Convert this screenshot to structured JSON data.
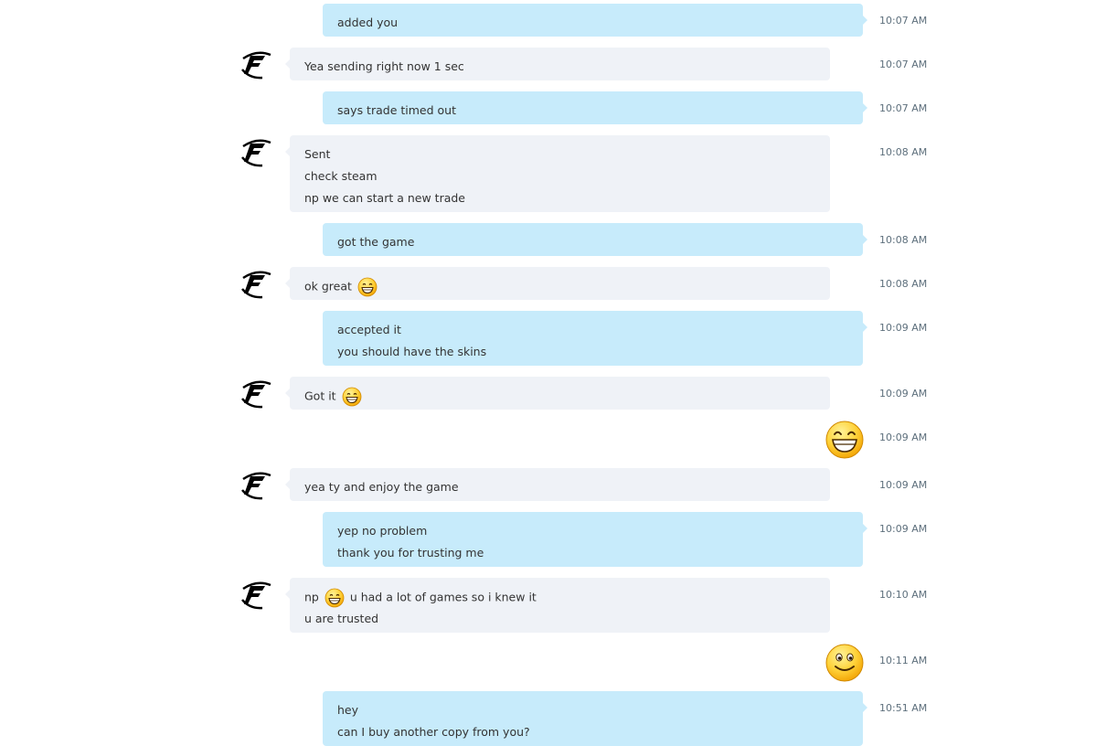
{
  "messages": [
    {
      "dir": "out",
      "lines": [
        "added you"
      ],
      "time": "10:07 AM"
    },
    {
      "dir": "in",
      "lines": [
        "Yea sending right now 1 sec"
      ],
      "time": "10:07 AM"
    },
    {
      "dir": "out",
      "lines": [
        "says trade timed out"
      ],
      "time": "10:07 AM"
    },
    {
      "dir": "in",
      "lines": [
        "Sent",
        "check steam",
        "np we can start a new trade"
      ],
      "time": "10:08 AM"
    },
    {
      "dir": "out",
      "lines": [
        "got the game"
      ],
      "time": "10:08 AM"
    },
    {
      "dir": "in",
      "lines": [
        "ok great",
        ""
      ],
      "time": "10:08 AM"
    },
    {
      "dir": "out",
      "lines": [
        "accepted it",
        "you should have the skins"
      ],
      "time": "10:09 AM"
    },
    {
      "dir": "in",
      "lines": [
        "Got it",
        ""
      ],
      "time": "10:09 AM"
    },
    {
      "dir": "out",
      "emoticon": "grin-emoticon",
      "time": "10:09 AM"
    },
    {
      "dir": "in",
      "lines": [
        "yea ty and enjoy the game"
      ],
      "time": "10:09 AM"
    },
    {
      "dir": "out",
      "lines": [
        "yep no problem",
        "thank you for trusting me"
      ],
      "time": "10:09 AM"
    },
    {
      "dir": "in",
      "lines": [
        "np",
        "u had a lot of games so i knew it",
        "u are trusted"
      ],
      "time": "10:10 AM"
    },
    {
      "dir": "out",
      "emoticon": "smile-emoticon",
      "time": "10:11 AM"
    },
    {
      "dir": "out",
      "lines": [
        "hey",
        "can I buy another copy from you?"
      ],
      "time": "10:51 AM"
    }
  ],
  "avatar_icon": "contact-avatar-f-logo",
  "colors": {
    "incoming_bubble": "#eff2f7",
    "outgoing_bubble": "#c7ebfb",
    "timestamp": "#5d6f7c",
    "text": "#333333"
  }
}
